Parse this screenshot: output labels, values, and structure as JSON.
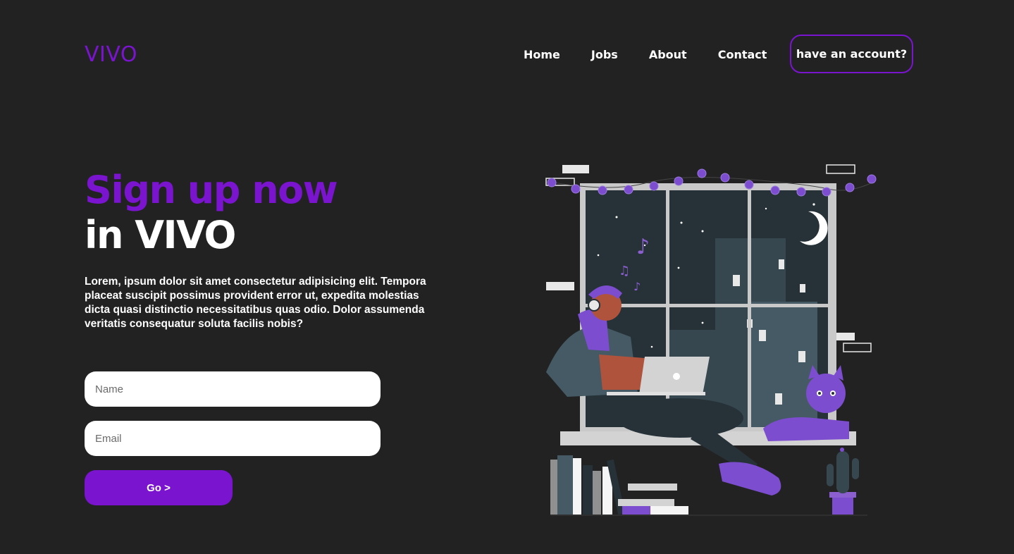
{
  "header": {
    "logo": "VIVO",
    "nav": [
      "Home",
      "Jobs",
      "About",
      "Contact"
    ],
    "account_button": "have an account?"
  },
  "hero": {
    "title_line1": "Sign up now",
    "title_line2": "in VIVO",
    "description": "Lorem, ipsum dolor sit amet consectetur adipisicing elit. Tempora placeat suscipit possimus provident error ut, expedita molestias dicta quasi distinctio necessitatibus quas odio. Dolor assumenda veritatis consequatur soluta facilis nobis?"
  },
  "form": {
    "name_placeholder": "Name",
    "email_placeholder": "Email",
    "submit_label": "Go >"
  },
  "colors": {
    "accent": "#7a14cf",
    "background": "#222223",
    "text": "#ffffff"
  },
  "illustration": {
    "icon": "person-working-at-window-illustration"
  }
}
